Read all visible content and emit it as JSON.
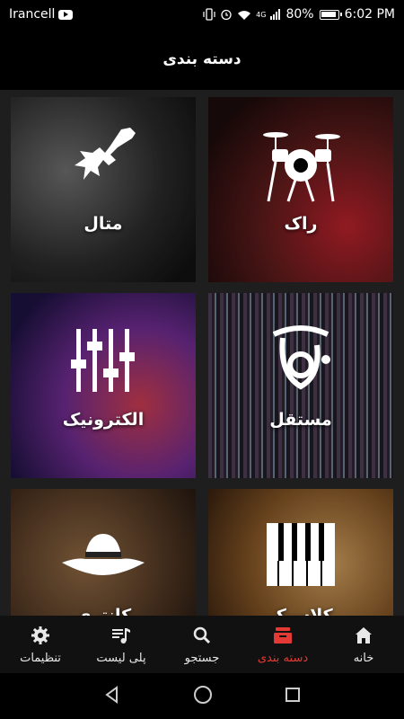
{
  "status_bar": {
    "carrier": "Irancell",
    "battery_percent": "80%",
    "time": "6:02 PM",
    "network": "4G",
    "icons": [
      "youtube-icon",
      "vibrate-icon",
      "alarm-icon",
      "wifi-icon",
      "signal-icon",
      "battery-icon"
    ]
  },
  "header": {
    "title": "دسته بندی"
  },
  "categories": [
    {
      "label": "متال",
      "icon": "electric-guitar-icon"
    },
    {
      "label": "راک",
      "icon": "drum-kit-icon"
    },
    {
      "label": "الکترونیک",
      "icon": "mixer-sliders-icon"
    },
    {
      "label": "مستقل",
      "icon": "tuba-icon"
    },
    {
      "label": "کانتری",
      "icon": "cowboy-hat-icon"
    },
    {
      "label": "کلاسیک",
      "icon": "piano-keys-icon"
    }
  ],
  "bottom_nav": {
    "active_color": "#e53935",
    "items": [
      {
        "label": "خانه",
        "icon": "home-icon"
      },
      {
        "label": "دسته بندی",
        "icon": "category-icon",
        "active": true
      },
      {
        "label": "جستجو",
        "icon": "search-icon"
      },
      {
        "label": "پلی لیست",
        "icon": "playlist-icon"
      },
      {
        "label": "تنظیمات",
        "icon": "gear-icon"
      }
    ]
  },
  "system_nav": [
    "back-icon",
    "home-circle-icon",
    "recents-icon"
  ]
}
